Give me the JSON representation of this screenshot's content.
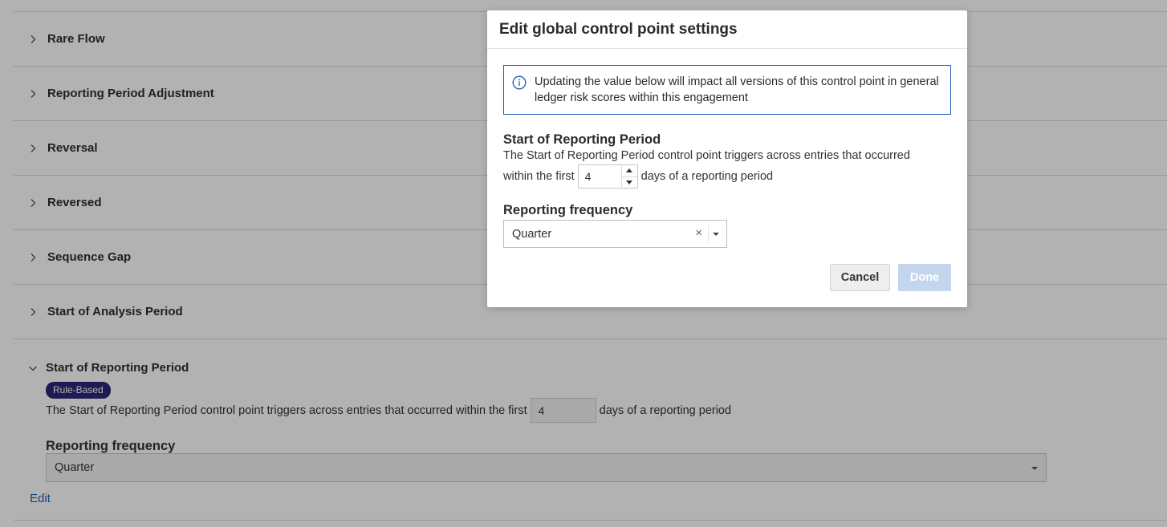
{
  "accordion": {
    "items": [
      {
        "label": "Rare Flow"
      },
      {
        "label": "Reporting Period Adjustment"
      },
      {
        "label": "Reversal"
      },
      {
        "label": "Reversed"
      },
      {
        "label": "Sequence Gap"
      },
      {
        "label": "Start of Analysis Period"
      }
    ],
    "expanded": {
      "title": "Start of Reporting Period",
      "badge": "Rule-Based",
      "desc_before": "The Start of Reporting Period control point triggers across entries that occurred within the first",
      "days_value": "4",
      "desc_after": "days of a reporting period",
      "frequency_label": "Reporting frequency",
      "frequency_value": "Quarter",
      "edit_link": "Edit"
    }
  },
  "modal": {
    "title": "Edit global control point settings",
    "info_text": "Updating the value below will impact all versions of this control point in general ledger risk scores within this engagement",
    "section_title": "Start of Reporting Period",
    "desc_line1": "The Start of Reporting Period control point triggers across entries that occurred",
    "desc_line2_before": "within the first",
    "days_value": "4",
    "desc_line2_after": "days of a reporting period",
    "frequency_label": "Reporting frequency",
    "frequency_value": "Quarter",
    "clear_glyph": "×",
    "cancel_label": "Cancel",
    "done_label": "Done"
  },
  "colors": {
    "accent": "#1f5fb8",
    "badge": "#2c2677",
    "done_disabled": "#c3d6ee"
  }
}
